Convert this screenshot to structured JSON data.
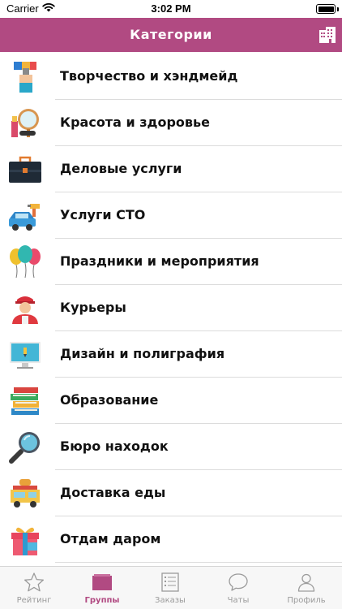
{
  "status_bar": {
    "carrier": "Carrier",
    "time": "3:02 PM"
  },
  "nav": {
    "title": "Категории",
    "right_icon": "buildings-icon"
  },
  "colors": {
    "accent": "#b14a82",
    "tab_inactive": "#9b9b9b",
    "separator": "#dcdcdc"
  },
  "categories": [
    {
      "label": "Творчество и хэндмейд",
      "icon": "paintbrush-hand-icon"
    },
    {
      "label": "Красота и здоровье",
      "icon": "mirror-cosmetics-icon"
    },
    {
      "label": "Деловые услуги",
      "icon": "briefcase-icon"
    },
    {
      "label": "Услуги СТО",
      "icon": "car-spray-gun-icon"
    },
    {
      "label": "Праздники и мероприятия",
      "icon": "balloons-icon"
    },
    {
      "label": "Курьеры",
      "icon": "courier-icon"
    },
    {
      "label": "Дизайн и полиграфия",
      "icon": "monitor-design-icon"
    },
    {
      "label": "Образование",
      "icon": "books-icon"
    },
    {
      "label": "Бюро находок",
      "icon": "magnifier-icon"
    },
    {
      "label": "Доставка еды",
      "icon": "food-truck-icon"
    },
    {
      "label": "Отдам даром",
      "icon": "gift-icon"
    }
  ],
  "tabs": [
    {
      "label": "Рейтинг",
      "icon": "star-icon",
      "active": false
    },
    {
      "label": "Группы",
      "icon": "folder-icon",
      "active": true
    },
    {
      "label": "Заказы",
      "icon": "list-icon",
      "active": false
    },
    {
      "label": "Чаты",
      "icon": "chat-icon",
      "active": false
    },
    {
      "label": "Профиль",
      "icon": "person-icon",
      "active": false
    }
  ]
}
